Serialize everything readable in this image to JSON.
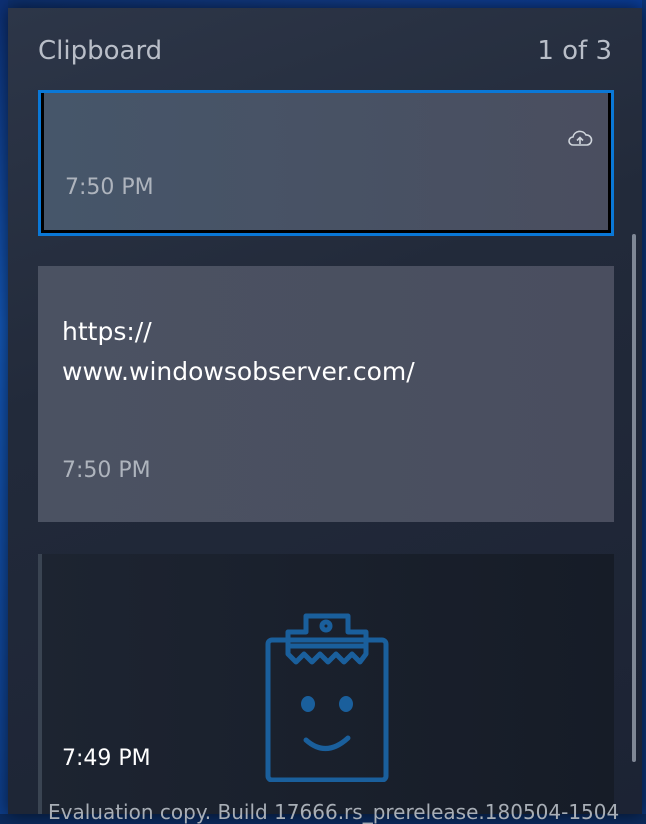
{
  "header": {
    "title": "Clipboard",
    "page_count": "1 of 3"
  },
  "items": [
    {
      "time": "7:50 PM",
      "text": "",
      "selected": true
    },
    {
      "time": "7:50 PM",
      "text": "https://\nwww.windowsobserver.com/"
    },
    {
      "time": "7:49 PM",
      "text": ""
    }
  ],
  "icons": {
    "cloud_sync": "cloud-upload-icon",
    "clipboard_art": "clipboard-smiley-icon"
  },
  "colors": {
    "accent": "#0a78d7",
    "panel": "#222a3a",
    "card": "#4a4e5f"
  },
  "footer_text": "Evaluation copy. Build 17666.rs_prerelease.180504-1504"
}
